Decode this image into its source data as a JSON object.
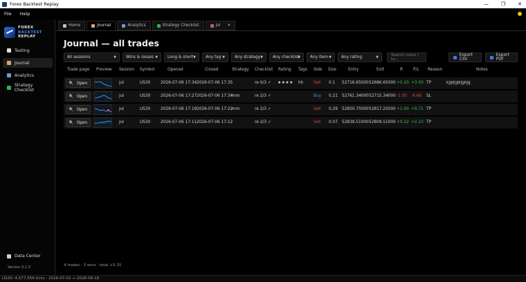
{
  "window": {
    "title": "Forex Backtest Replay",
    "controls": [
      "—",
      "❐",
      "✕"
    ]
  },
  "menu": {
    "file": "File",
    "help": "Help"
  },
  "colors": {
    "accent": "#3b8af0",
    "positive": "#36c24f",
    "negative": "#e04848",
    "status_dot": "#f4c20d"
  },
  "sidebar": {
    "logo": {
      "line1": "FOREX",
      "line2": "BACKTEST",
      "line3": "REPLAY"
    },
    "items": [
      {
        "label": "Testing",
        "icon": "testing-icon"
      },
      {
        "label": "Journal",
        "icon": "journal-icon"
      },
      {
        "label": "Analytics",
        "icon": "analytics-icon"
      },
      {
        "label": "Strategy  Checklist",
        "icon": "checklist-icon"
      }
    ],
    "data_center": "Data Center",
    "version": "Version 0.2.3"
  },
  "tabs": [
    {
      "label": "Home"
    },
    {
      "label": "Journal"
    },
    {
      "label": "Analytics"
    },
    {
      "label": "Strategy  Checklist"
    },
    {
      "label": "jul",
      "close": "✕"
    }
  ],
  "journal": {
    "title": "Journal — all trades",
    "filters": {
      "sessions": "All sessions",
      "outcome": "Wins & losses",
      "direction": "Long & short",
      "tag": "Any tag",
      "strategy": "Any strategy",
      "checklist": "Any checklist",
      "item": "Any item",
      "rating": "Any rating",
      "search_placeholder": "Search notes / ta..."
    },
    "export_csv": "Export CSV",
    "export_pdf": "Export PDF",
    "columns": [
      "Trade page",
      "Preview",
      "Session",
      "Symbol",
      "Opened",
      "Closed",
      "Strategy",
      "Checklist",
      "Rating",
      "Tags",
      "Side",
      "Size",
      "Entry",
      "Exit",
      "R",
      "P/L",
      "Reason",
      "Notes"
    ],
    "open_label": "Open",
    "rows": [
      {
        "session": "jul",
        "symbol": "US30",
        "opened": "2026-07-06 17:34",
        "closed": "2026-07-06 17:35",
        "strategy": "",
        "checklist": "re  0/3 ✓",
        "rating": "★★★★",
        "tags": "hh",
        "side": "Sell",
        "size": "0.1",
        "entry": "52716.65000",
        "exit": "52686.65000",
        "r": "+0.20",
        "pl": "+3.00",
        "reason": "TP",
        "notes": "kjgkjgkjgkjg"
      },
      {
        "session": "jul",
        "symbol": "US30",
        "opened": "2026-07-06 17:27",
        "closed": "2026-07-06 17:34",
        "strategy": "mm",
        "checklist": "re  2/3 ✓",
        "rating": "",
        "tags": "",
        "side": "Buy",
        "size": "0.21",
        "entry": "52761.34000",
        "exit": "52715.34000",
        "r": "-1.00",
        "pl": "-9.66",
        "reason": "SL",
        "notes": ""
      },
      {
        "session": "jul",
        "symbol": "US30",
        "opened": "2026-07-06 17:19",
        "closed": "2026-07-06 17:22",
        "strategy": "mm",
        "checklist": "re  2/3 ✓",
        "rating": "",
        "tags": "",
        "side": "Sell",
        "size": "0.29",
        "entry": "52850.75000",
        "exit": "52817.25000",
        "r": "+1.00",
        "pl": "+9.71",
        "reason": "TP",
        "notes": ""
      },
      {
        "session": "jul",
        "symbol": "US30",
        "opened": "2026-07-06 17:11",
        "closed": "2026-07-06 17:12",
        "strategy": "",
        "checklist": "re  2/3 ✓",
        "rating": "",
        "tags": "",
        "side": "Sell",
        "size": "0.07",
        "entry": "52839.51000",
        "exit": "52809.51000",
        "r": "+0.22",
        "pl": "+2.10",
        "reason": "TP",
        "notes": ""
      }
    ],
    "summary": "4 trades · 3 wins · total +5.15"
  },
  "statusbar": "US30: 4,577,556 ticks · 2026-07-02 → 2026-08-18"
}
